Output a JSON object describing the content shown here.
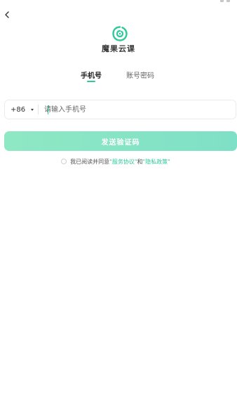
{
  "header": {
    "app_name": "魔果云课"
  },
  "tabs": [
    {
      "label": "手机号"
    },
    {
      "label": "账号密码"
    }
  ],
  "phone_form": {
    "country_code": "+86",
    "placeholder": "请输入手机号",
    "value": ""
  },
  "send_button": {
    "label": "发送验证码"
  },
  "agreement": {
    "prefix": "我已阅读并同意",
    "service_link": "\"服务协议\"",
    "and_text": "和",
    "privacy_link": "\"隐私政策\""
  },
  "colors": {
    "accent": "#2fc99a",
    "button_gradient_start": "#8fe8c4",
    "button_gradient_end": "#7ee0c6"
  },
  "icons": {
    "back": "back-arrow-icon",
    "logo": "app-logo-icon",
    "caret": "caret-down-icon"
  }
}
